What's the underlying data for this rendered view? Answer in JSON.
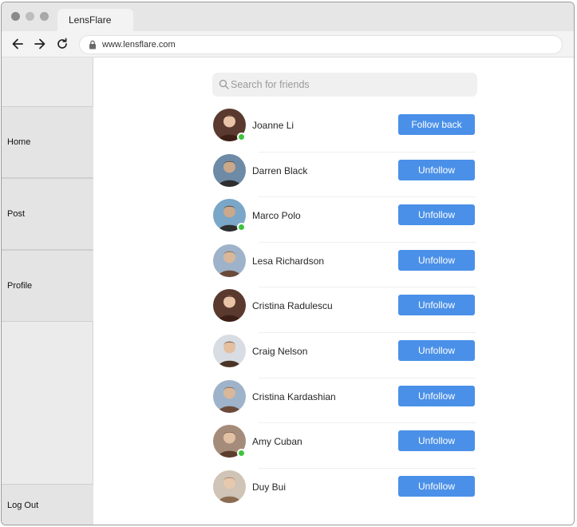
{
  "browser": {
    "tab_title": "LensFlare",
    "url": "www.lensflare.com"
  },
  "sidebar": {
    "items": [
      {
        "label": "Home"
      },
      {
        "label": "Post"
      },
      {
        "label": "Profile"
      }
    ],
    "logout_label": "Log Out"
  },
  "search": {
    "placeholder": "Search for friends",
    "value": ""
  },
  "friends": [
    {
      "name": "Joanne Li",
      "button": "Follow back",
      "online": true
    },
    {
      "name": "Darren Black",
      "button": "Unfollow",
      "online": false
    },
    {
      "name": "Marco Polo",
      "button": "Unfollow",
      "online": true
    },
    {
      "name": "Lesa Richardson",
      "button": "Unfollow",
      "online": false
    },
    {
      "name": "Cristina Radulescu",
      "button": "Unfollow",
      "online": false
    },
    {
      "name": "Craig Nelson",
      "button": "Unfollow",
      "online": false
    },
    {
      "name": "Cristina Kardashian",
      "button": "Unfollow",
      "online": false
    },
    {
      "name": "Amy Cuban",
      "button": "Unfollow",
      "online": true
    },
    {
      "name": "Duy Bui",
      "button": "Unfollow",
      "online": false
    }
  ],
  "colors": {
    "button": "#4a90e8",
    "online": "#3fc43c",
    "sidebar": "#ebebeb"
  }
}
